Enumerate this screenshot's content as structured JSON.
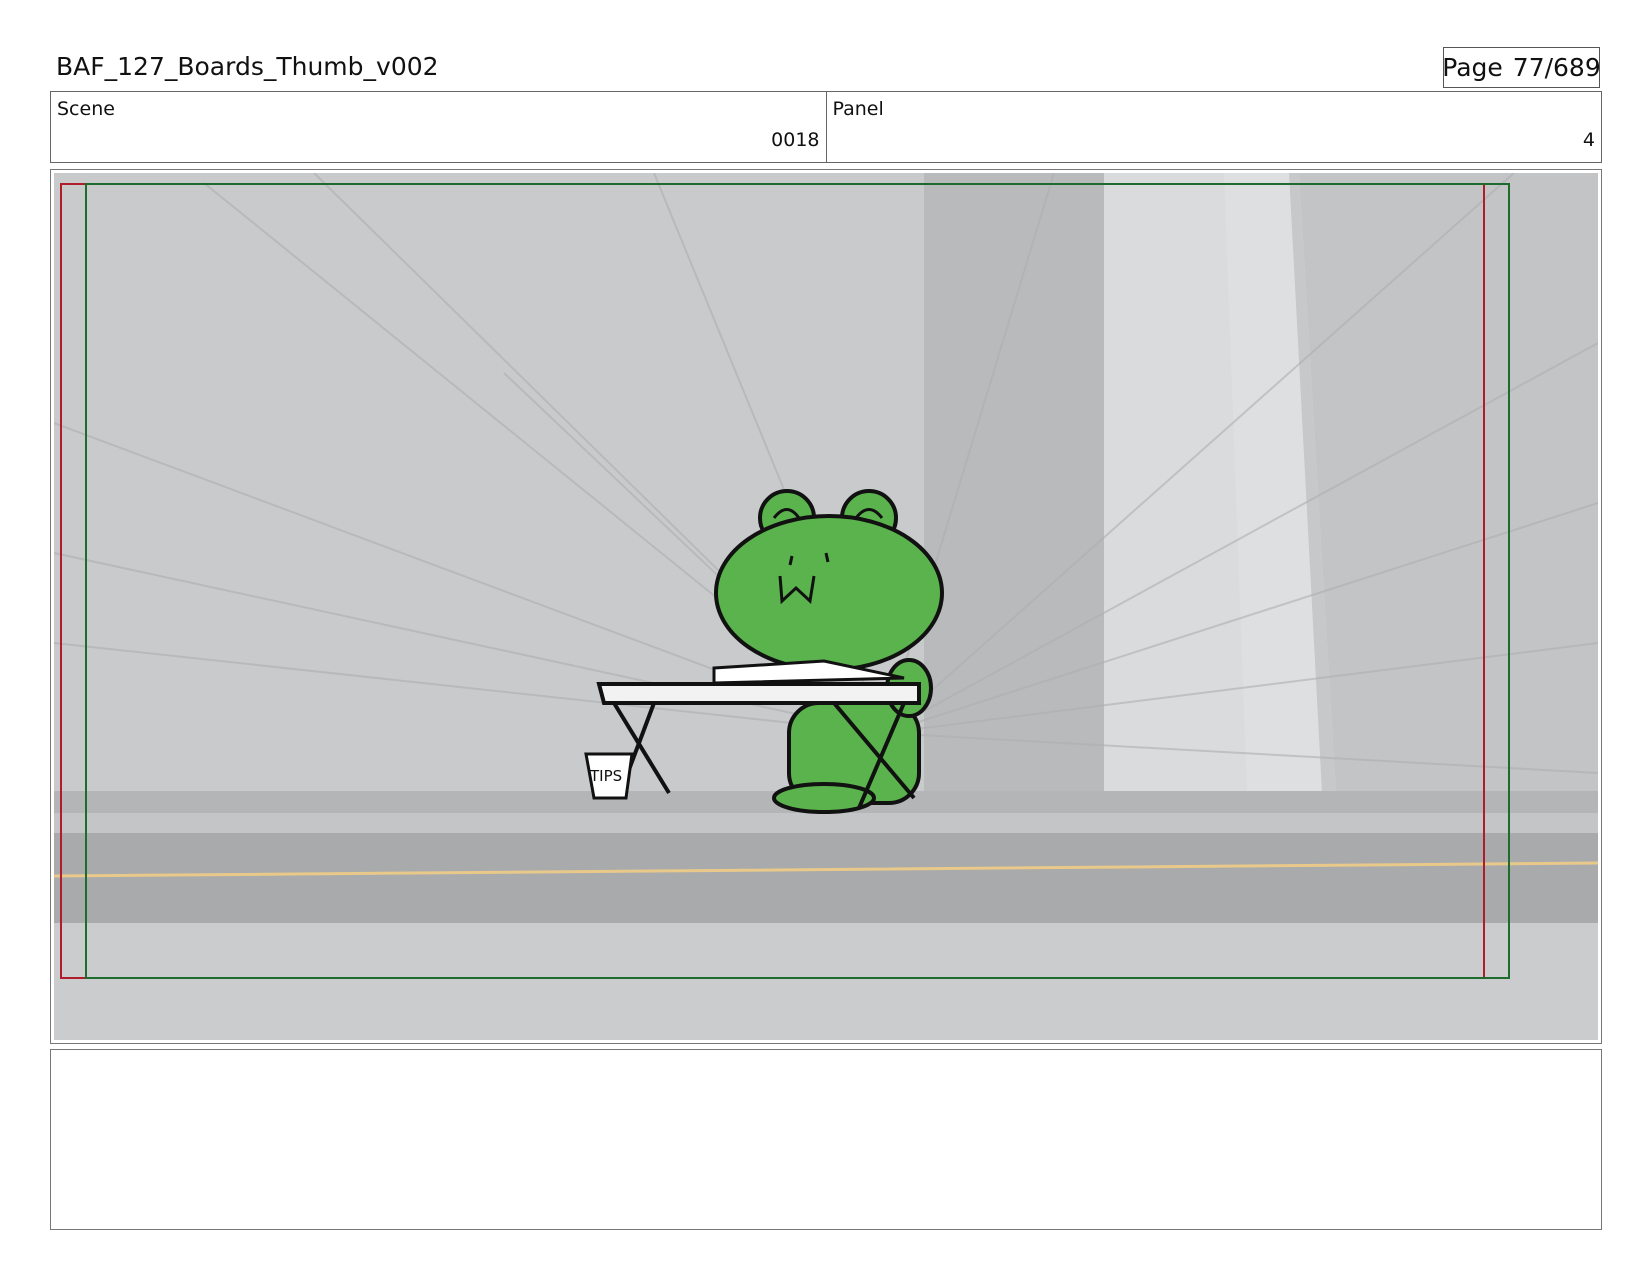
{
  "header": {
    "doc_title": "BAF_127_Boards_Thumb_v002",
    "page_label": "Page",
    "page_value": "77/689"
  },
  "fields": {
    "scene_label": "Scene",
    "scene_value": "0018",
    "panel_label": "Panel",
    "panel_value": "4"
  },
  "frame": {
    "tip_jar_text": "TIPS",
    "safe_area_color": "#b01c2a",
    "action_area_color": "#1e6b2e",
    "character_color": "#5ab34c",
    "road_line_color": "#e8c98a"
  },
  "notes": {
    "text": ""
  }
}
